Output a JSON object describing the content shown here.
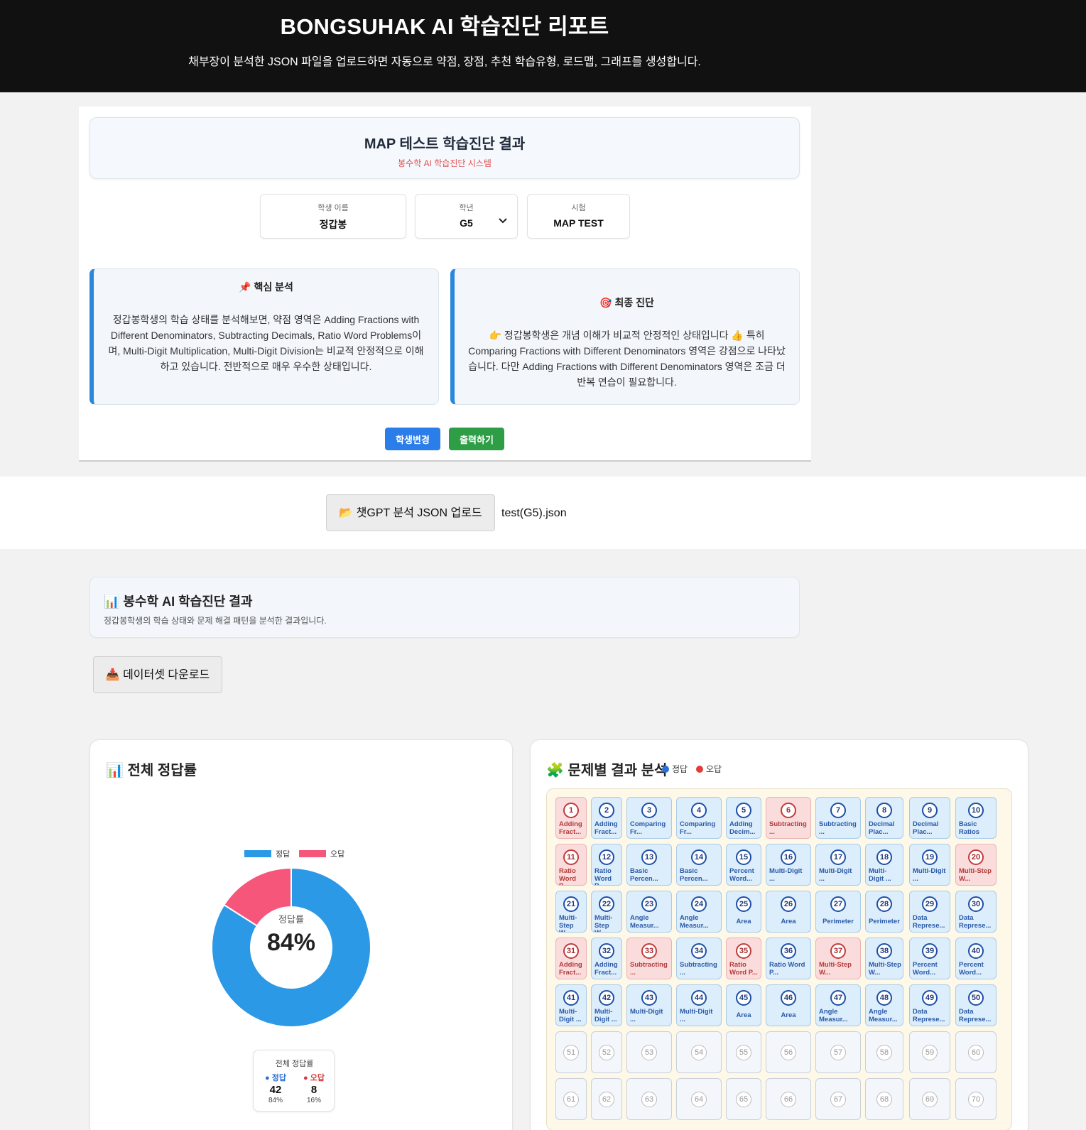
{
  "header": {
    "title": "BONGSUHAK AI 학습진단 리포트",
    "subtitle": "채부장이 분석한 JSON 파일을 업로드하면 자동으로 약점, 장점, 추천 학습유형, 로드맵, 그래프를 생성합니다."
  },
  "report": {
    "title": "MAP 테스트 학습진단 결과",
    "subtitle": "봉수학 AI 학습진단 시스템",
    "student_label": "학생 이름",
    "student_value": "정갑봉",
    "grade_label": "학년",
    "grade_value": "G5",
    "exam_label": "시험",
    "exam_value": "MAP TEST",
    "core_title": "📌 핵심 분석",
    "core_body": "정갑봉학생의 학습 상태를 분석해보면, 약점 영역은 Adding Fractions with Different Denominators, Subtracting Decimals, Ratio Word Problems이며, Multi-Digit Multiplication, Multi-Digit Division는 비교적 안정적으로 이해하고 있습니다. 전반적으로 매우 우수한 상태입니다.",
    "final_title": "🎯 최종 진단",
    "final_body": "👉 정갑봉학생은 개념 이해가 비교적 안정적인 상태입니다 👍 특히 Comparing Fractions with Different Denominators 영역은 강점으로 나타났습니다. 다만 Adding Fractions with Different Denominators 영역은 조금 더 반복 연습이 필요합니다.",
    "change_student": "학생변경",
    "print": "출력하기"
  },
  "upload": {
    "button": "📂 챗GPT 분석 JSON 업로드",
    "filename": "test(G5).json"
  },
  "results": {
    "title": "📊 봉수학 AI 학습진단 결과",
    "subtitle": "정갑봉학생의 학습 상태와 문제 해결 패턴을 분석한 결과입니다.",
    "download": "📥 데이터셋 다운로드"
  },
  "accuracy_card": {
    "title": "📊 전체 정답률",
    "center_label": "정답률",
    "center_value": "84%",
    "summary_title": "전체 정답률",
    "correct_label": "● 정답",
    "wrong_label": "● 오답",
    "correct_count": "42",
    "wrong_count": "8",
    "correct_pct": "84%",
    "wrong_pct": "16%"
  },
  "chart_data": {
    "type": "pie",
    "categories": [
      "정답",
      "오답"
    ],
    "values": [
      42,
      8
    ],
    "colors": [
      "#2b99e6",
      "#f5567a"
    ],
    "legend": "top",
    "donut": true
  },
  "problems_card": {
    "title": "🧩 문제별 결과 분석",
    "key_correct": "정답",
    "key_wrong": "오답"
  },
  "problems": [
    {
      "n": 1,
      "label": "Adding Fract...",
      "status": "wrong"
    },
    {
      "n": 2,
      "label": "Adding Fract...",
      "status": "correct"
    },
    {
      "n": 3,
      "label": "Comparing Fr...",
      "status": "correct"
    },
    {
      "n": 4,
      "label": "Comparing Fr...",
      "status": "correct"
    },
    {
      "n": 5,
      "label": "Adding Decim...",
      "status": "correct"
    },
    {
      "n": 6,
      "label": "Subtracting ...",
      "status": "wrong"
    },
    {
      "n": 7,
      "label": "Subtracting ...",
      "status": "correct"
    },
    {
      "n": 8,
      "label": "Decimal Plac...",
      "status": "correct"
    },
    {
      "n": 9,
      "label": "Decimal Plac...",
      "status": "correct"
    },
    {
      "n": 10,
      "label": "Basic Ratios",
      "status": "correct"
    },
    {
      "n": 11,
      "label": "Ratio Word P...",
      "status": "wrong"
    },
    {
      "n": 12,
      "label": "Ratio Word P...",
      "status": "correct"
    },
    {
      "n": 13,
      "label": "Basic Percen...",
      "status": "correct"
    },
    {
      "n": 14,
      "label": "Basic Percen...",
      "status": "correct"
    },
    {
      "n": 15,
      "label": "Percent Word...",
      "status": "correct"
    },
    {
      "n": 16,
      "label": "Multi-Digit ...",
      "status": "correct"
    },
    {
      "n": 17,
      "label": "Multi-Digit ...",
      "status": "correct"
    },
    {
      "n": 18,
      "label": "Multi-Digit ...",
      "status": "correct"
    },
    {
      "n": 19,
      "label": "Multi-Digit ...",
      "status": "correct"
    },
    {
      "n": 20,
      "label": "Multi-Step W...",
      "status": "wrong"
    },
    {
      "n": 21,
      "label": "Multi-Step W...",
      "status": "correct"
    },
    {
      "n": 22,
      "label": "Multi-Step W...",
      "status": "correct"
    },
    {
      "n": 23,
      "label": "Angle Measur...",
      "status": "correct"
    },
    {
      "n": 24,
      "label": "Angle Measur...",
      "status": "correct"
    },
    {
      "n": 25,
      "label": "Area",
      "status": "correct"
    },
    {
      "n": 26,
      "label": "Area",
      "status": "correct"
    },
    {
      "n": 27,
      "label": "Perimeter",
      "status": "correct"
    },
    {
      "n": 28,
      "label": "Perimeter",
      "status": "correct"
    },
    {
      "n": 29,
      "label": "Data Represe...",
      "status": "correct"
    },
    {
      "n": 30,
      "label": "Data Represe...",
      "status": "correct"
    },
    {
      "n": 31,
      "label": "Adding Fract...",
      "status": "wrong"
    },
    {
      "n": 32,
      "label": "Adding Fract...",
      "status": "correct"
    },
    {
      "n": 33,
      "label": "Subtracting ...",
      "status": "wrong"
    },
    {
      "n": 34,
      "label": "Subtracting ...",
      "status": "correct"
    },
    {
      "n": 35,
      "label": "Ratio Word P...",
      "status": "wrong"
    },
    {
      "n": 36,
      "label": "Ratio Word P...",
      "status": "correct"
    },
    {
      "n": 37,
      "label": "Multi-Step W...",
      "status": "wrong"
    },
    {
      "n": 38,
      "label": "Multi-Step W...",
      "status": "correct"
    },
    {
      "n": 39,
      "label": "Percent Word...",
      "status": "correct"
    },
    {
      "n": 40,
      "label": "Percent Word...",
      "status": "correct"
    },
    {
      "n": 41,
      "label": "Multi-Digit ...",
      "status": "correct"
    },
    {
      "n": 42,
      "label": "Multi-Digit ...",
      "status": "correct"
    },
    {
      "n": 43,
      "label": "Multi-Digit ...",
      "status": "correct"
    },
    {
      "n": 44,
      "label": "Multi-Digit ...",
      "status": "correct"
    },
    {
      "n": 45,
      "label": "Area",
      "status": "correct"
    },
    {
      "n": 46,
      "label": "Area",
      "status": "correct"
    },
    {
      "n": 47,
      "label": "Angle Measur...",
      "status": "correct"
    },
    {
      "n": 48,
      "label": "Angle Measur...",
      "status": "correct"
    },
    {
      "n": 49,
      "label": "Data Represe...",
      "status": "correct"
    },
    {
      "n": 50,
      "label": "Data Represe...",
      "status": "correct"
    },
    {
      "n": 51,
      "label": "",
      "status": "empty"
    },
    {
      "n": 52,
      "label": "",
      "status": "empty"
    },
    {
      "n": 53,
      "label": "",
      "status": "empty"
    },
    {
      "n": 54,
      "label": "",
      "status": "empty"
    },
    {
      "n": 55,
      "label": "",
      "status": "empty"
    },
    {
      "n": 56,
      "label": "",
      "status": "empty"
    },
    {
      "n": 57,
      "label": "",
      "status": "empty"
    },
    {
      "n": 58,
      "label": "",
      "status": "empty"
    },
    {
      "n": 59,
      "label": "",
      "status": "empty"
    },
    {
      "n": 60,
      "label": "",
      "status": "empty"
    },
    {
      "n": 61,
      "label": "",
      "status": "empty"
    },
    {
      "n": 62,
      "label": "",
      "status": "empty"
    },
    {
      "n": 63,
      "label": "",
      "status": "empty"
    },
    {
      "n": 64,
      "label": "",
      "status": "empty"
    },
    {
      "n": 65,
      "label": "",
      "status": "empty"
    },
    {
      "n": 66,
      "label": "",
      "status": "empty"
    },
    {
      "n": 67,
      "label": "",
      "status": "empty"
    },
    {
      "n": 68,
      "label": "",
      "status": "empty"
    },
    {
      "n": 69,
      "label": "",
      "status": "empty"
    },
    {
      "n": 70,
      "label": "",
      "status": "empty"
    }
  ]
}
